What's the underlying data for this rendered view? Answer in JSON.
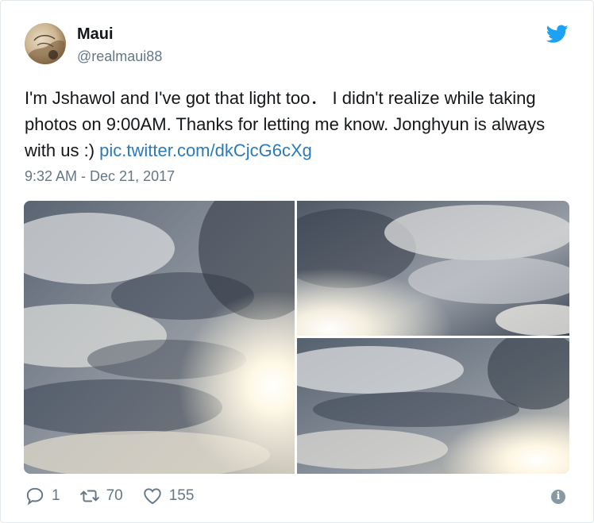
{
  "user": {
    "name": "Maui",
    "handle": "@realmaui88"
  },
  "tweet": {
    "text": "I'm Jshawol and I've got that light too． I didn't realize while taking photos on 9:00AM. Thanks for letting me know. Jonghyun is always with us :) ",
    "link": "pic.twitter.com/dkCjcG6cXg",
    "timestamp": "9:32 AM - Dec 21, 2017"
  },
  "media": [
    {
      "description": "cloudy sky photo 1"
    },
    {
      "description": "cloudy sky photo 2"
    },
    {
      "description": "cloudy sky photo 3"
    }
  ],
  "actions": {
    "replies": "1",
    "retweets": "70",
    "likes": "155"
  },
  "colors": {
    "link": "#2b7bb9",
    "brand": "#1da1f2",
    "muted": "#657786"
  },
  "icons": [
    "twitter-bird-icon",
    "reply-icon",
    "retweet-icon",
    "heart-icon",
    "info-icon"
  ]
}
